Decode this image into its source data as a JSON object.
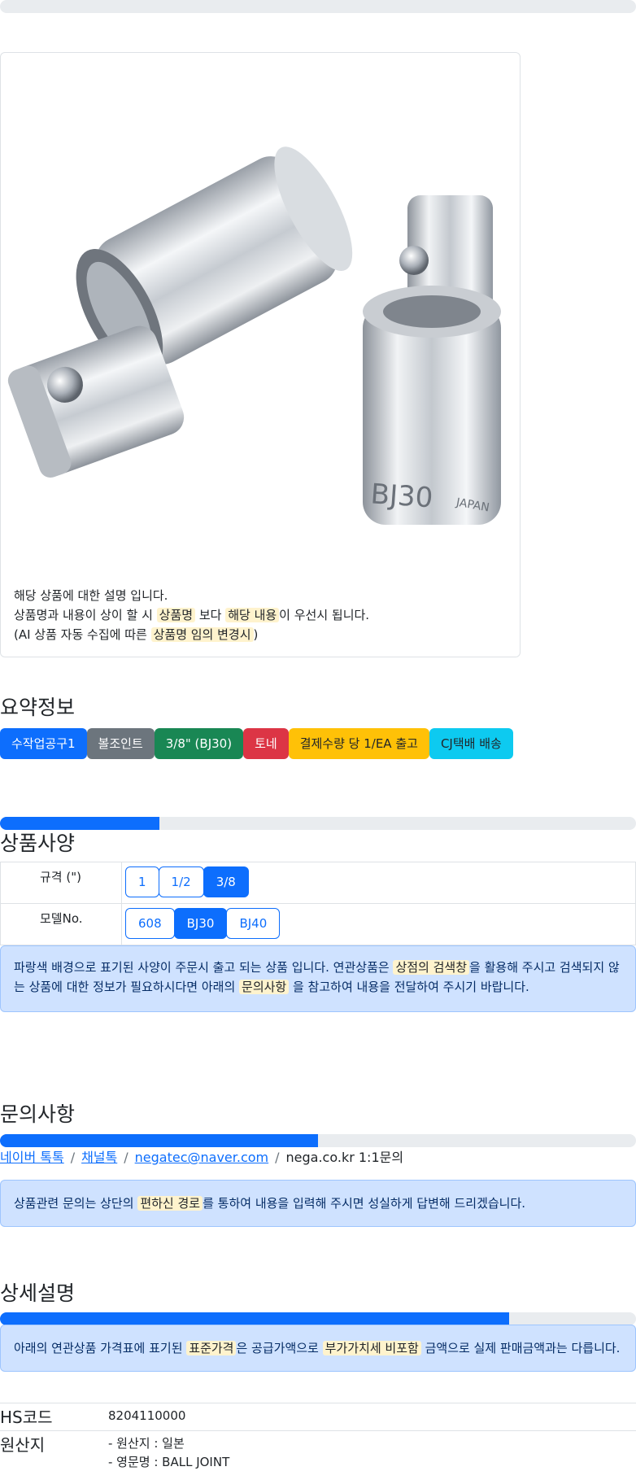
{
  "product_card": {
    "image_alt": "universal joint sockets",
    "desc_line1": "해당 상품에 대한 설명 입니다.",
    "desc_line2_a": "상품명과 내용이 상이 할 시 ",
    "desc_line2_mark1": "상품명",
    "desc_line2_b": " 보다 ",
    "desc_line2_mark2": "해당 내용",
    "desc_line2_c": "이 우선시 됩니다.",
    "desc_line3_a": "(AI 상품 자동 수집에 따른 ",
    "desc_line3_mark": "상품명 임의 변경시",
    "desc_line3_b": ")"
  },
  "summary": {
    "title": "요약정보",
    "badges": [
      {
        "label": "수작업공구1",
        "color": "#0d6efd"
      },
      {
        "label": "볼조인트",
        "color": "#6c757d"
      },
      {
        "label": "3/8\" (BJ30)",
        "color": "#198754"
      },
      {
        "label": "토네",
        "color": "#dc3545"
      },
      {
        "label": "결제수량 당 1/EA 출고",
        "color": "#ffc107"
      },
      {
        "label": "CJ택배 배송",
        "color": "#0dcaf0"
      }
    ]
  },
  "spec": {
    "progress": 0.25,
    "title": "상품사양",
    "rows": [
      {
        "label": "규격 (\")",
        "options": [
          "1",
          "1/2",
          "3/8"
        ],
        "active": "3/8"
      },
      {
        "label": "모델No.",
        "options": [
          "608",
          "BJ30",
          "BJ40"
        ],
        "active": "BJ30"
      }
    ],
    "notice_a": "파랑색 배경으로 표기된 사양이 주문시 출고 되는 상품 입니다. 연관상품은 ",
    "notice_mark1": "상점의 검색창",
    "notice_b": "을 활용해 주시고 검색되지 않",
    "notice_c": "는 상품에 대한 정보가 필요하시다면 아래의 ",
    "notice_mark2": "문의사항",
    "notice_d": " 을 참고하여 내용을 전달하여 주시기 바랍니다."
  },
  "inquiry": {
    "title": "문의사항",
    "progress": 0.5,
    "links": [
      "네이버 톡톡",
      "채널톡",
      "negatec@naver.com"
    ],
    "plain": "nega.co.kr 1:1문의",
    "separator": "/",
    "notice_a": "상품관련 문의는 상단의 ",
    "notice_mark": "편하신 경로",
    "notice_b": "를 통하여 내용을 입력해 주시면 성실하게 답변해 드리겠습니다."
  },
  "detail": {
    "title": "상세설명",
    "progress": 0.8,
    "notice_a": "아래의 연관상품 가격표에 표기된 ",
    "notice_mark1": "표준가격",
    "notice_b": "은 공급가액으로 ",
    "notice_mark2": "부가가치세 비포함",
    "notice_c": " 금액으로 실제 판매금액과는 다릅니다."
  },
  "info": {
    "hs_label": "HS코드",
    "hs_value": "8204110000",
    "origin_label": "원산지",
    "origin_line1": "- 원산지 : 일본",
    "origin_line2": "- 영문명 : BALL JOINT"
  }
}
